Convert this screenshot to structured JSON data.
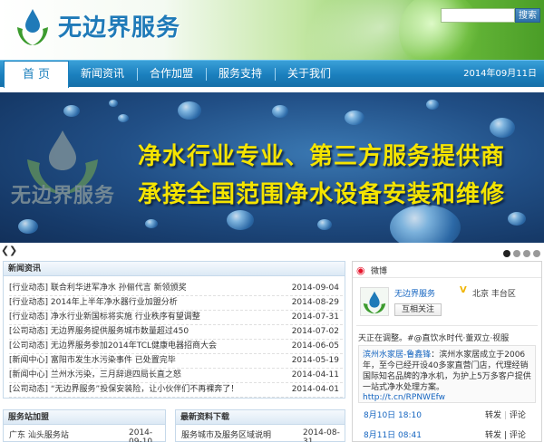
{
  "header": {
    "logo_text": "无边界服务",
    "search_placeholder": "",
    "search_button": "搜索"
  },
  "nav": {
    "items": [
      {
        "label": "首 页"
      },
      {
        "label": "新闻资讯"
      },
      {
        "label": "合作加盟"
      },
      {
        "label": "服务支持"
      },
      {
        "label": "关于我们"
      }
    ],
    "date": "2014年09月11日"
  },
  "banner": {
    "brand": "无边界服务",
    "line1": "净水行业专业、第三方服务提供商",
    "line2": "承接全国范围净水设备安装和维修",
    "prev": "❮",
    "next": "❯",
    "slides": 4,
    "active_slide": 0
  },
  "news": {
    "header": "新闻资讯",
    "rows": [
      {
        "title": "[行业动态] 联合利华进军净水 孙俪代言 新领颁奖",
        "date": "2014-09-04"
      },
      {
        "title": "[行业动态] 2014年上半年净水器行业加盟分析",
        "date": "2014-08-29"
      },
      {
        "title": "[行业动态] 净水行业新国标将实施 行业秩序有望调整",
        "date": "2014-07-31"
      },
      {
        "title": "[公司动态] 无边界服务提供服务城市数量超过450",
        "date": "2014-07-02"
      },
      {
        "title": "[公司动态] 无边界服务参加2014年TCL健康电器招商大会",
        "date": "2014-06-05"
      },
      {
        "title": "[新闻中心] 富阳市发生水污染事件 已处置完毕",
        "date": "2014-05-19"
      },
      {
        "title": "[新闻中心] 兰州水污染，三月辞退四局长直之怒",
        "date": "2014-04-11"
      },
      {
        "title": "[公司动态] “无边界服务”投保安装险，让小伙伴们不再裸奔了！",
        "date": "2014-04-01"
      }
    ]
  },
  "station": {
    "header": "服务站加盟",
    "item": "广东  汕头服务站",
    "date": "2014-09-10"
  },
  "download": {
    "header": "最新资料下载",
    "item": "服务城市及服务区域说明",
    "date": "2014-08-31"
  },
  "weibo": {
    "title": "微博",
    "profile_name": "无边界服务",
    "verified": "V",
    "location": "北京 丰台区",
    "follow": "互相关注",
    "status": "天正在调整。#@直饮水时代·董双立·视服",
    "post_author": "滨州水家居-鲁鑫锋",
    "post_text": "：滨州水家居成立于2006年，至今已经开设40多家直营门店，代理经销国际知名品牌的净水机，为护上5万多客户提供一站式净水处理方案。",
    "post_link": "http://t.cn/RPNWEfw",
    "post_time": "8月10日 18:10",
    "repost": "转发",
    "comment": "评论",
    "post2_time": "8月11日 08:41",
    "repost2": "转发",
    "comment2": "评论"
  }
}
